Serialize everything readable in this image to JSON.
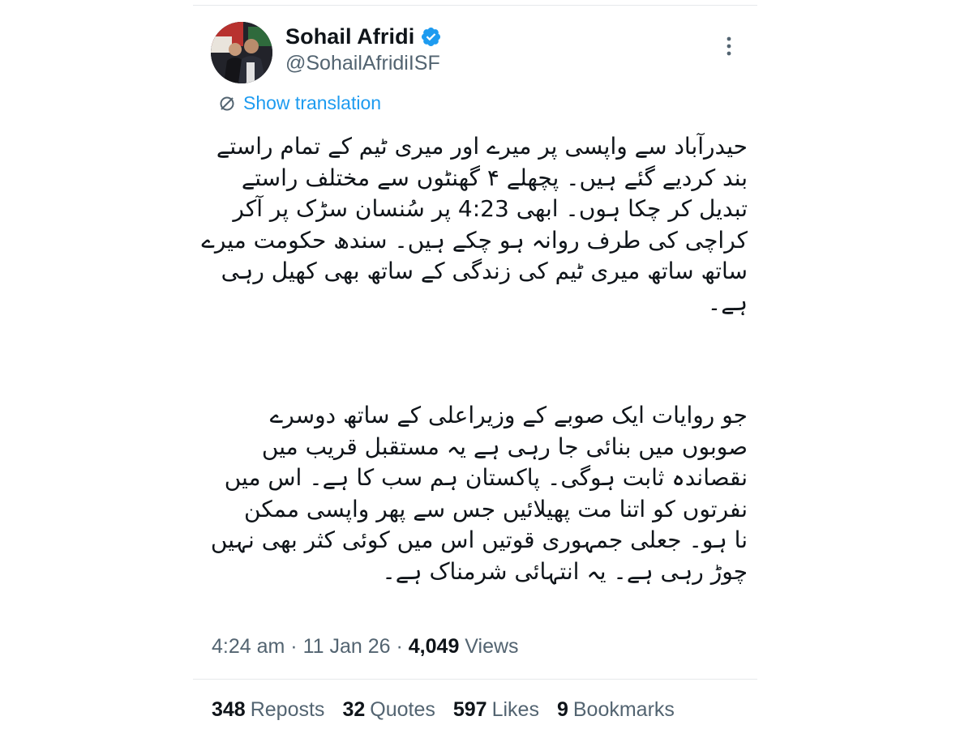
{
  "author": {
    "name": "Sohail Afridi",
    "handle": "@SohailAfridiISF",
    "verified_icon": "verified-badge-icon",
    "avatar_icon": "avatar-photo"
  },
  "menu": {
    "icon": "more-options-icon"
  },
  "translation": {
    "icon": "translate-icon",
    "label": "Show translation"
  },
  "body": {
    "paragraph1": [
      "حیدرآباد سے واپسی پر میرے اور میری ٹیم کے تمام راستے",
      "بند کردیے گئے ہیں۔ پچھلے ۴ گھنٹوں سے مختلف راستے",
      "تبدیل کر چکا ہوں۔ ابھی 4:23 پر سُنسان سڑک پر آکر",
      "کراچی کی طرف روانہ ہو چکے ہیں۔ سندھ حکومت میرے",
      "ساتھ ساتھ میری ٹیم کی زندگی کے ساتھ بھی کھیل رہی",
      "ہے۔"
    ],
    "paragraph2": [
      "جو روایات ایک صوبے کے وزیراعلی کے ساتھ دوسرے",
      "صوبوں میں بنائی جا رہی ہے یہ مستقبل قریب میں",
      "نقصاندہ ثابت ہوگی۔ پاکستان ہم سب کا ہے۔ اس میں",
      "نفرتوں کو اتنا مت پھیلائیں جس سے پھر واپسی ممکن",
      "نا ہو۔ جعلی جمہوری قوتیں اس میں کوئی کثر بھی نہیں",
      "چوڑ رہی ہے۔ یہ انتہائی شرمناک ہے۔"
    ]
  },
  "meta": {
    "time": "4:24 am",
    "separator": "·",
    "date": "11 Jan 26",
    "views_count": "4,049",
    "views_label": "Views"
  },
  "stats": [
    {
      "count": "348",
      "label": "Reposts"
    },
    {
      "count": "32",
      "label": "Quotes"
    },
    {
      "count": "597",
      "label": "Likes"
    },
    {
      "count": "9",
      "label": "Bookmarks"
    }
  ],
  "colors": {
    "accent": "#1d9bf0",
    "text": "#0f1419",
    "secondary": "#536471"
  }
}
